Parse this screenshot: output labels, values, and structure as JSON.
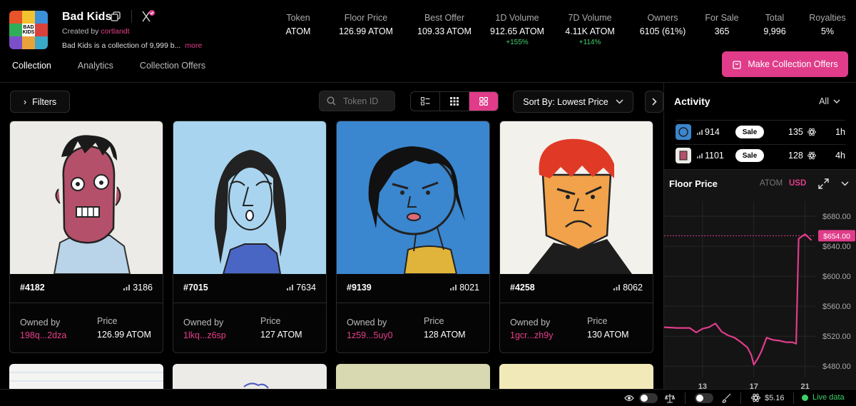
{
  "collection": {
    "name": "Bad Kids",
    "creator_prefix": "Created by ",
    "creator": "cortlandt",
    "description": "Bad Kids is a collection of 9,999 b...",
    "more_label": "more",
    "logo_text": "BAD KIDS"
  },
  "stats": [
    {
      "label": "Token",
      "value": "ATOM",
      "change": ""
    },
    {
      "label": "Floor Price",
      "value": "126.99 ATOM",
      "change": ""
    },
    {
      "label": "Best Offer",
      "value": "109.33 ATOM",
      "change": ""
    },
    {
      "label": "1D Volume",
      "value": "912.65 ATOM",
      "change": "+155%"
    },
    {
      "label": "7D Volume",
      "value": "4.11K ATOM",
      "change": "+114%"
    },
    {
      "label": "Owners",
      "value": "6105 (61%)",
      "change": ""
    },
    {
      "label": "For Sale",
      "value": "365",
      "change": ""
    },
    {
      "label": "Total",
      "value": "9,996",
      "change": ""
    },
    {
      "label": "Royalties",
      "value": "5%",
      "change": ""
    }
  ],
  "tabs": [
    "Collection",
    "Analytics",
    "Collection Offers"
  ],
  "make_offer_label": "Make Collection Offers",
  "toolbar": {
    "filters_label": "Filters",
    "search_placeholder": "Token ID",
    "sort_label": "Sort By: Lowest Price"
  },
  "cards": [
    {
      "id": "#4182",
      "rank": "3186",
      "owned_by_label": "Owned by",
      "owner": "198q...2dza",
      "price_label": "Price",
      "price": "126.99 ATOM"
    },
    {
      "id": "#7015",
      "rank": "7634",
      "owned_by_label": "Owned by",
      "owner": "1lkq...z6sp",
      "price_label": "Price",
      "price": "127 ATOM"
    },
    {
      "id": "#9139",
      "rank": "8021",
      "owned_by_label": "Owned by",
      "owner": "1z59...5uy0",
      "price_label": "Price",
      "price": "128 ATOM"
    },
    {
      "id": "#4258",
      "rank": "8062",
      "owned_by_label": "Owned by",
      "owner": "1gcr...zh9y",
      "price_label": "Price",
      "price": "130 ATOM"
    }
  ],
  "activity": {
    "title": "Activity",
    "filter": "All",
    "rows": [
      {
        "rank": "914",
        "type": "Sale",
        "amount": "135",
        "time": "1h"
      },
      {
        "rank": "1101",
        "type": "Sale",
        "amount": "128",
        "time": "4h"
      }
    ]
  },
  "floor_chart": {
    "title": "Floor Price",
    "currency_a": "ATOM",
    "currency_b": "USD",
    "current_label": "$654.00",
    "y_ticks": [
      "$680.00",
      "$640.00",
      "$600.00",
      "$560.00",
      "$520.00",
      "$480.00"
    ],
    "x_ticks": [
      "13",
      "17",
      "21"
    ]
  },
  "chart_data": {
    "type": "line",
    "title": "Floor Price",
    "xlabel": "",
    "ylabel": "",
    "ylim": [
      465,
      700
    ],
    "x": [
      10,
      11,
      12,
      12.5,
      13,
      13.5,
      14,
      14.5,
      15,
      15.5,
      16,
      16.5,
      16.8,
      17,
      17.3,
      17.6,
      18,
      18.5,
      19,
      19.5,
      20,
      20.3,
      20.5,
      21,
      21.5
    ],
    "values": [
      532,
      531,
      531,
      525,
      530,
      532,
      537,
      526,
      521,
      518,
      512,
      505,
      495,
      482,
      490,
      500,
      518,
      515,
      514,
      512,
      512,
      510,
      650,
      656,
      648
    ],
    "current_value": 654,
    "grid": true
  },
  "footer": {
    "price": "$5.16",
    "live_label": "Live data"
  }
}
